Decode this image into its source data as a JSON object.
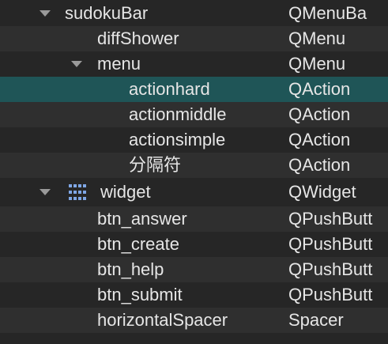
{
  "tree": {
    "rows": [
      {
        "name": "sudokuBar",
        "class": "QMenuBa"
      },
      {
        "name": "diffShower",
        "class": "QMenu"
      },
      {
        "name": "menu",
        "class": "QMenu"
      },
      {
        "name": "actionhard",
        "class": "QAction"
      },
      {
        "name": "actionmiddle",
        "class": "QAction"
      },
      {
        "name": "actionsimple",
        "class": "QAction"
      },
      {
        "name": "分隔符",
        "class": "QAction"
      },
      {
        "name": "widget",
        "class": "QWidget"
      },
      {
        "name": "btn_answer",
        "class": "QPushButt"
      },
      {
        "name": "btn_create",
        "class": "QPushButt"
      },
      {
        "name": "btn_help",
        "class": "QPushButt"
      },
      {
        "name": "btn_submit",
        "class": "QPushButt"
      },
      {
        "name": "horizontalSpacer",
        "class": "Spacer"
      }
    ],
    "selected_row": "actionhard",
    "icons": {
      "expand": "expand-arrow-icon",
      "widget": "grid-layout-icon"
    }
  },
  "colors": {
    "background": "#262626",
    "alt_row": "#2f2f2f",
    "selected": "#1f5557",
    "text": "#e6e6e6"
  }
}
